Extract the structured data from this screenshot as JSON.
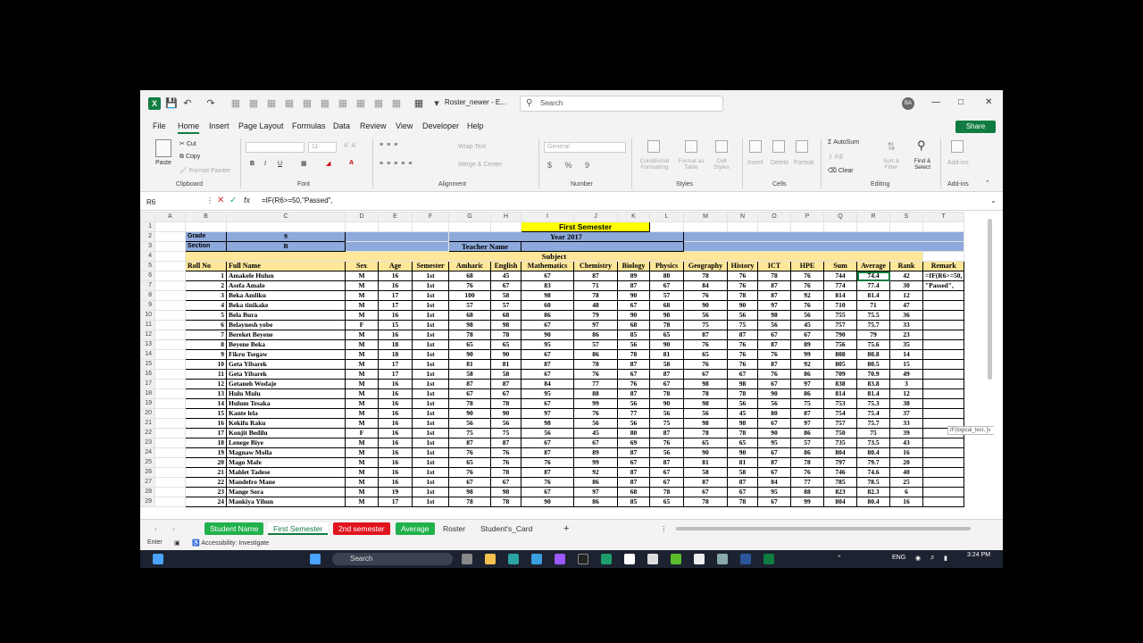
{
  "titlebar": {
    "doc_title": "Roster_newer  -  E...",
    "search_placeholder": "Search",
    "avatar": "BA"
  },
  "menu": [
    "File",
    "Home",
    "Insert",
    "Page Layout",
    "Formulas",
    "Data",
    "Review",
    "View",
    "Developer",
    "Help"
  ],
  "share_label": "Share",
  "ribbon": {
    "clipboard": {
      "paste": "Paste",
      "cut": "Cut",
      "copy": "Copy",
      "format_painter": "Format Painter",
      "label": "Clipboard"
    },
    "font": {
      "name": "",
      "size": "11",
      "label": "Font"
    },
    "alignment": {
      "wrap": "Wrap Text",
      "merge": "Merge & Center",
      "label": "Alignment"
    },
    "number": {
      "format": "General",
      "label": "Number"
    },
    "styles": {
      "cond": "Conditional Formatting",
      "table": "Format as Table",
      "cell": "Cell Styles",
      "label": "Styles"
    },
    "cells": {
      "insert": "Insert",
      "delete": "Delete",
      "format": "Format",
      "label": "Cells"
    },
    "editing": {
      "autosum": "AutoSum",
      "fill": "Fill",
      "clear": "Clear",
      "sort": "Sort & Filter",
      "find": "Find & Select",
      "label": "Editing"
    },
    "addins": {
      "addins": "Add-ins",
      "label": "Add-ins"
    }
  },
  "formula_bar": {
    "cell": "R6",
    "formula": "=IF(R6>=50,\"Passed\","
  },
  "columns": [
    "A",
    "B",
    "C",
    "D",
    "E",
    "F",
    "G",
    "H",
    "I",
    "J",
    "K",
    "L",
    "M",
    "N",
    "O",
    "P",
    "Q",
    "R",
    "S",
    "T"
  ],
  "header": {
    "first_semester": "First Semester",
    "grade_label": "Grade",
    "grade": "9",
    "section_label": "Section",
    "section": "B",
    "year": "Year  2017",
    "teacher": "Teacher  Name",
    "subject": "Subject",
    "cols": [
      "Roll  No",
      "Full  Name",
      "Sex",
      "Age",
      "Semester",
      "Amharic",
      "English",
      "Mathematics",
      "Chemistry",
      "Biology",
      "Physics",
      "Geography",
      "History",
      "ICT",
      "HPE",
      "Sum",
      "Average",
      "Rank",
      "Remark"
    ]
  },
  "students": [
    [
      1,
      "Amakele Hulun",
      "M",
      16,
      "1st",
      68,
      45,
      67,
      87,
      89,
      80,
      78,
      76,
      78,
      76,
      744,
      "74.4",
      42
    ],
    [
      2,
      "Asefa Amalo",
      "M",
      16,
      "1st",
      76,
      67,
      83,
      71,
      87,
      67,
      84,
      76,
      87,
      76,
      774,
      "77.4",
      30
    ],
    [
      3,
      "Beka Amliku",
      "M",
      17,
      "1st",
      100,
      58,
      98,
      78,
      90,
      57,
      76,
      78,
      87,
      92,
      814,
      "81.4",
      12
    ],
    [
      4,
      "Beka tinikake",
      "M",
      17,
      "1st",
      57,
      57,
      60,
      48,
      67,
      68,
      90,
      90,
      97,
      76,
      710,
      "71",
      47
    ],
    [
      5,
      "Bela Bura",
      "M",
      16,
      "1st",
      68,
      68,
      86,
      79,
      90,
      98,
      56,
      56,
      98,
      56,
      755,
      "75.5",
      36
    ],
    [
      6,
      "Belaynesh yobe",
      "F",
      15,
      "1st",
      98,
      98,
      67,
      97,
      68,
      78,
      75,
      75,
      56,
      45,
      757,
      "75.7",
      33
    ],
    [
      7,
      "Bereket Beyene",
      "M",
      16,
      "1st",
      78,
      78,
      90,
      86,
      85,
      65,
      87,
      87,
      67,
      67,
      790,
      "79",
      23
    ],
    [
      8,
      "Beyene Beka",
      "M",
      18,
      "1st",
      65,
      65,
      95,
      57,
      56,
      90,
      76,
      76,
      87,
      89,
      756,
      "75.6",
      35
    ],
    [
      9,
      "Fikru Tsegaw",
      "M",
      18,
      "1st",
      90,
      90,
      67,
      86,
      78,
      81,
      65,
      76,
      76,
      99,
      808,
      "80.8",
      14
    ],
    [
      10,
      "Geta Yibarek",
      "M",
      17,
      "1st",
      81,
      81,
      87,
      78,
      87,
      58,
      76,
      76,
      87,
      92,
      805,
      "80.5",
      15
    ],
    [
      11,
      "Geta Yibarek",
      "M",
      17,
      "1st",
      58,
      58,
      67,
      76,
      67,
      87,
      67,
      67,
      76,
      86,
      709,
      "70.9",
      49
    ],
    [
      12,
      "Getaneh Wodaje",
      "M",
      16,
      "1st",
      87,
      87,
      84,
      77,
      76,
      67,
      98,
      98,
      67,
      97,
      838,
      "83.8",
      3
    ],
    [
      13,
      "Hulu Mulu",
      "M",
      16,
      "1st",
      67,
      67,
      95,
      88,
      87,
      78,
      78,
      78,
      90,
      86,
      814,
      "81.4",
      12
    ],
    [
      14,
      "Hulum Tesaka",
      "M",
      16,
      "1st",
      78,
      78,
      67,
      99,
      56,
      90,
      98,
      56,
      56,
      75,
      753,
      "75.3",
      38
    ],
    [
      15,
      "Kante lela",
      "M",
      16,
      "1st",
      90,
      90,
      97,
      76,
      77,
      56,
      56,
      45,
      80,
      87,
      754,
      "75.4",
      37
    ],
    [
      16,
      "Kekifu Raku",
      "M",
      16,
      "1st",
      56,
      56,
      98,
      56,
      56,
      75,
      98,
      98,
      67,
      97,
      757,
      "75.7",
      33
    ],
    [
      17,
      "Konjit Bedilu",
      "F",
      16,
      "1st",
      75,
      75,
      56,
      45,
      80,
      87,
      78,
      78,
      90,
      86,
      750,
      "75",
      39
    ],
    [
      18,
      "Lenege Biye",
      "M",
      16,
      "1st",
      87,
      87,
      67,
      67,
      69,
      76,
      65,
      65,
      95,
      57,
      735,
      "73.5",
      43
    ],
    [
      19,
      "Magnaw Molla",
      "M",
      16,
      "1st",
      76,
      76,
      87,
      89,
      87,
      56,
      90,
      90,
      67,
      86,
      804,
      "80.4",
      16
    ],
    [
      20,
      "Mago Mafe",
      "M",
      16,
      "1st",
      65,
      76,
      76,
      99,
      67,
      87,
      81,
      81,
      87,
      78,
      797,
      "79.7",
      20
    ],
    [
      21,
      "Mahlet Tadese",
      "M",
      16,
      "1st",
      76,
      78,
      87,
      92,
      87,
      67,
      58,
      58,
      67,
      76,
      746,
      "74.6",
      40
    ],
    [
      22,
      "Mandefro Mane",
      "M",
      16,
      "1st",
      67,
      67,
      76,
      86,
      87,
      67,
      87,
      87,
      84,
      77,
      785,
      "78.5",
      25
    ],
    [
      23,
      "Mange Sora",
      "M",
      19,
      "1st",
      98,
      98,
      67,
      97,
      68,
      78,
      67,
      67,
      95,
      88,
      823,
      "82.3",
      6
    ],
    [
      24,
      "Mankiya Yihun",
      "M",
      17,
      "1st",
      78,
      78,
      90,
      86,
      85,
      65,
      78,
      78,
      67,
      99,
      804,
      "80.4",
      16
    ]
  ],
  "edit_cell": {
    "line1": "=IF(R6>=50,",
    "line2": "\"Passed\",",
    "tooltip": "IF(logical_test, [v"
  },
  "sheet_tabs": [
    "Student Name",
    "First Semester",
    "2nd semester",
    "Average",
    "Roster",
    "Student's_Card"
  ],
  "status": {
    "mode": "Enter",
    "accessibility": "Accessibility: Investigate"
  },
  "taskbar": {
    "search": "Search",
    "lang": "ENG",
    "time": "3:24 PM"
  }
}
